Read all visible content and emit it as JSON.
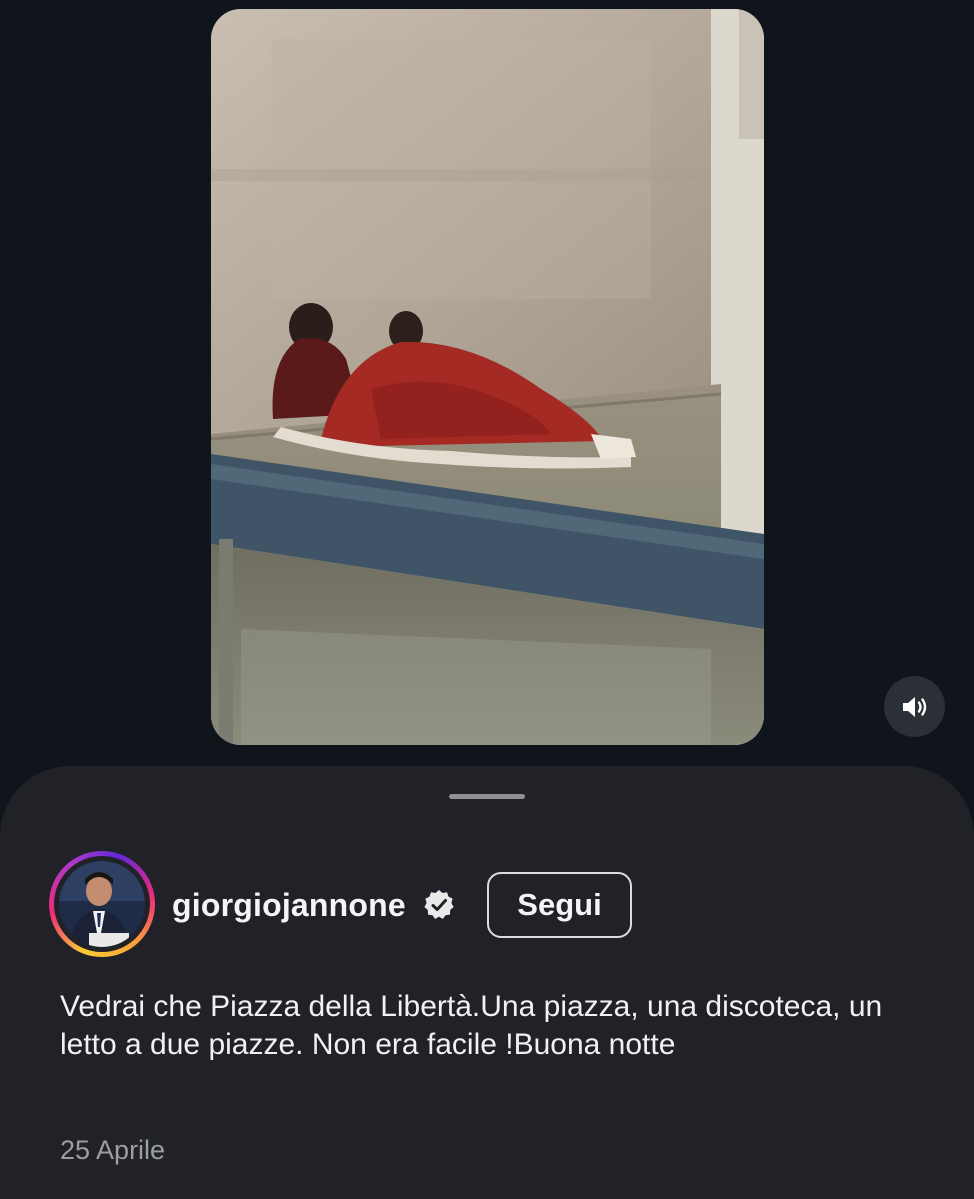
{
  "post": {
    "username": "giorgiojannone",
    "verified": true,
    "follow_label": "Segui",
    "caption": "Vedrai che Piazza della Libertà.Una piazza, una discoteca, un letto a due piazze. Non era facile !Buona notte",
    "date": "25 Aprile"
  },
  "video": {
    "sound_icon": "speaker-on-icon",
    "muted": false
  },
  "icons": {
    "verified": "verified-badge-icon",
    "sound": "speaker-on-icon",
    "handle": "drag-handle"
  },
  "colors": {
    "background": "#10141b",
    "sheet": "#202227",
    "text_primary": "#f4f4f5",
    "text_secondary": "#9c9ea3",
    "story_ring": [
      "#f9ce34",
      "#ee2a7b",
      "#6228d7"
    ]
  }
}
